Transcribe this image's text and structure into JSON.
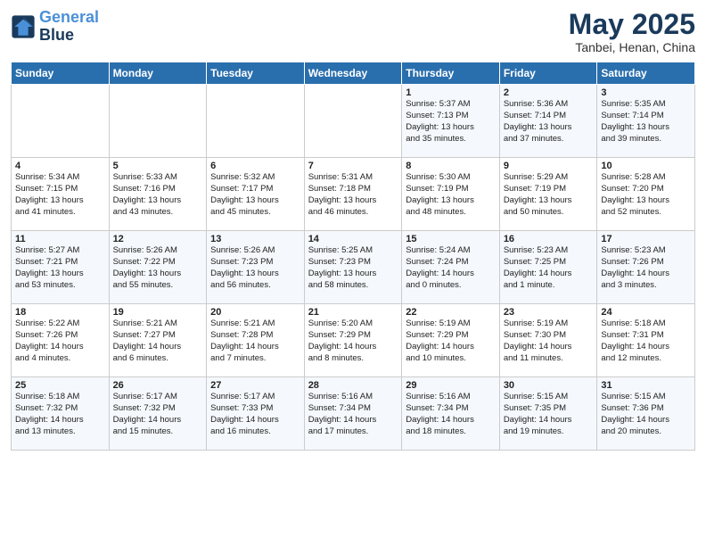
{
  "header": {
    "logo_line1": "General",
    "logo_line2": "Blue",
    "month": "May 2025",
    "location": "Tanbei, Henan, China"
  },
  "days_of_week": [
    "Sunday",
    "Monday",
    "Tuesday",
    "Wednesday",
    "Thursday",
    "Friday",
    "Saturday"
  ],
  "weeks": [
    [
      {
        "day": "",
        "info": ""
      },
      {
        "day": "",
        "info": ""
      },
      {
        "day": "",
        "info": ""
      },
      {
        "day": "",
        "info": ""
      },
      {
        "day": "1",
        "info": "Sunrise: 5:37 AM\nSunset: 7:13 PM\nDaylight: 13 hours\nand 35 minutes."
      },
      {
        "day": "2",
        "info": "Sunrise: 5:36 AM\nSunset: 7:14 PM\nDaylight: 13 hours\nand 37 minutes."
      },
      {
        "day": "3",
        "info": "Sunrise: 5:35 AM\nSunset: 7:14 PM\nDaylight: 13 hours\nand 39 minutes."
      }
    ],
    [
      {
        "day": "4",
        "info": "Sunrise: 5:34 AM\nSunset: 7:15 PM\nDaylight: 13 hours\nand 41 minutes."
      },
      {
        "day": "5",
        "info": "Sunrise: 5:33 AM\nSunset: 7:16 PM\nDaylight: 13 hours\nand 43 minutes."
      },
      {
        "day": "6",
        "info": "Sunrise: 5:32 AM\nSunset: 7:17 PM\nDaylight: 13 hours\nand 45 minutes."
      },
      {
        "day": "7",
        "info": "Sunrise: 5:31 AM\nSunset: 7:18 PM\nDaylight: 13 hours\nand 46 minutes."
      },
      {
        "day": "8",
        "info": "Sunrise: 5:30 AM\nSunset: 7:19 PM\nDaylight: 13 hours\nand 48 minutes."
      },
      {
        "day": "9",
        "info": "Sunrise: 5:29 AM\nSunset: 7:19 PM\nDaylight: 13 hours\nand 50 minutes."
      },
      {
        "day": "10",
        "info": "Sunrise: 5:28 AM\nSunset: 7:20 PM\nDaylight: 13 hours\nand 52 minutes."
      }
    ],
    [
      {
        "day": "11",
        "info": "Sunrise: 5:27 AM\nSunset: 7:21 PM\nDaylight: 13 hours\nand 53 minutes."
      },
      {
        "day": "12",
        "info": "Sunrise: 5:26 AM\nSunset: 7:22 PM\nDaylight: 13 hours\nand 55 minutes."
      },
      {
        "day": "13",
        "info": "Sunrise: 5:26 AM\nSunset: 7:23 PM\nDaylight: 13 hours\nand 56 minutes."
      },
      {
        "day": "14",
        "info": "Sunrise: 5:25 AM\nSunset: 7:23 PM\nDaylight: 13 hours\nand 58 minutes."
      },
      {
        "day": "15",
        "info": "Sunrise: 5:24 AM\nSunset: 7:24 PM\nDaylight: 14 hours\nand 0 minutes."
      },
      {
        "day": "16",
        "info": "Sunrise: 5:23 AM\nSunset: 7:25 PM\nDaylight: 14 hours\nand 1 minute."
      },
      {
        "day": "17",
        "info": "Sunrise: 5:23 AM\nSunset: 7:26 PM\nDaylight: 14 hours\nand 3 minutes."
      }
    ],
    [
      {
        "day": "18",
        "info": "Sunrise: 5:22 AM\nSunset: 7:26 PM\nDaylight: 14 hours\nand 4 minutes."
      },
      {
        "day": "19",
        "info": "Sunrise: 5:21 AM\nSunset: 7:27 PM\nDaylight: 14 hours\nand 6 minutes."
      },
      {
        "day": "20",
        "info": "Sunrise: 5:21 AM\nSunset: 7:28 PM\nDaylight: 14 hours\nand 7 minutes."
      },
      {
        "day": "21",
        "info": "Sunrise: 5:20 AM\nSunset: 7:29 PM\nDaylight: 14 hours\nand 8 minutes."
      },
      {
        "day": "22",
        "info": "Sunrise: 5:19 AM\nSunset: 7:29 PM\nDaylight: 14 hours\nand 10 minutes."
      },
      {
        "day": "23",
        "info": "Sunrise: 5:19 AM\nSunset: 7:30 PM\nDaylight: 14 hours\nand 11 minutes."
      },
      {
        "day": "24",
        "info": "Sunrise: 5:18 AM\nSunset: 7:31 PM\nDaylight: 14 hours\nand 12 minutes."
      }
    ],
    [
      {
        "day": "25",
        "info": "Sunrise: 5:18 AM\nSunset: 7:32 PM\nDaylight: 14 hours\nand 13 minutes."
      },
      {
        "day": "26",
        "info": "Sunrise: 5:17 AM\nSunset: 7:32 PM\nDaylight: 14 hours\nand 15 minutes."
      },
      {
        "day": "27",
        "info": "Sunrise: 5:17 AM\nSunset: 7:33 PM\nDaylight: 14 hours\nand 16 minutes."
      },
      {
        "day": "28",
        "info": "Sunrise: 5:16 AM\nSunset: 7:34 PM\nDaylight: 14 hours\nand 17 minutes."
      },
      {
        "day": "29",
        "info": "Sunrise: 5:16 AM\nSunset: 7:34 PM\nDaylight: 14 hours\nand 18 minutes."
      },
      {
        "day": "30",
        "info": "Sunrise: 5:15 AM\nSunset: 7:35 PM\nDaylight: 14 hours\nand 19 minutes."
      },
      {
        "day": "31",
        "info": "Sunrise: 5:15 AM\nSunset: 7:36 PM\nDaylight: 14 hours\nand 20 minutes."
      }
    ]
  ]
}
